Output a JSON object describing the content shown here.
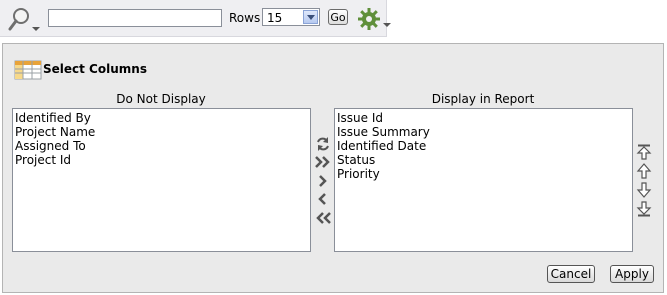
{
  "toolbar": {
    "search_icon": "search-magnifier-icon",
    "search_value": "",
    "rows_label": "Rows",
    "rows_selected": "15",
    "go_label": "Go",
    "actions_icon": "gear-icon"
  },
  "select_columns": {
    "title": "Select Columns",
    "title_icon": "columns-table-icon",
    "do_not_display": {
      "heading": "Do Not Display",
      "items": [
        "Identified By",
        "Project Name",
        "Assigned To",
        "Project Id"
      ]
    },
    "display_in_report": {
      "heading": "Display in Report",
      "items": [
        "Issue Id",
        "Issue Summary",
        "Identified Date",
        "Status",
        "Priority"
      ]
    },
    "move_controls": [
      "reset-icon",
      "move-all-right-icon",
      "move-right-icon",
      "move-left-icon",
      "move-all-left-icon"
    ],
    "order_controls": [
      "move-top-icon",
      "move-up-icon",
      "move-down-icon",
      "move-bottom-icon"
    ],
    "cancel_label": "Cancel",
    "apply_label": "Apply"
  }
}
